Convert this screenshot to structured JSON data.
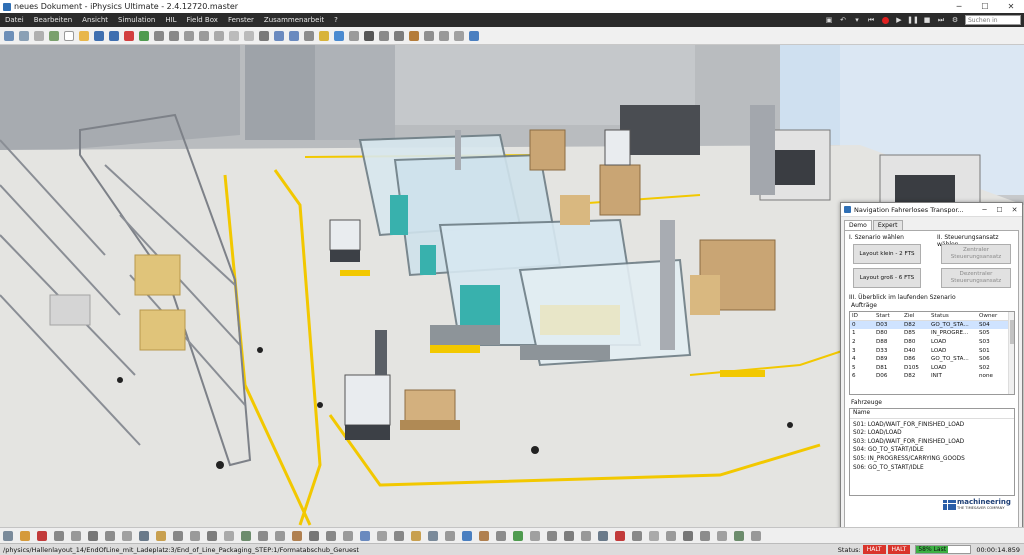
{
  "window": {
    "title": "neues Dokument - iPhysics Ultimate - 2.4.12720.master"
  },
  "menu": {
    "items": [
      "Datei",
      "Bearbeiten",
      "Ansicht",
      "Simulation",
      "HIL",
      "Field Box",
      "Fenster",
      "Zusammenarbeit",
      "?"
    ],
    "search_placeholder": "Suchen in Wissens..."
  },
  "panel": {
    "title": "Navigation Fahrerloses Transpor...",
    "tabs": [
      "Demo",
      "Expert"
    ],
    "section_scenario": "I. Szenario wählen",
    "btn_small": "Layout klein - 2 FTS",
    "btn_large": "Layout groß - 6 FTS",
    "section_control": "II. Steuerungsansatz wählen",
    "btn_central": "Zentraler Steuerungsansatz",
    "btn_decentral": "Dezentraler Steuerungsansatz",
    "section_overview": "III. Überblick im laufenden Szenario",
    "orders_label": "Aufträge",
    "orders_headers": [
      "ID",
      "Start",
      "Ziel",
      "Status",
      "Owner"
    ],
    "orders": [
      [
        "0",
        "D03",
        "D82",
        "GO_TO_STA...",
        "S04"
      ],
      [
        "1",
        "D80",
        "D85",
        "IN_PROGRE...",
        "S05"
      ],
      [
        "2",
        "D88",
        "D80",
        "LOAD",
        "S03"
      ],
      [
        "3",
        "D33",
        "D40",
        "LOAD",
        "S01"
      ],
      [
        "4",
        "D89",
        "D86",
        "GO_TO_STA...",
        "S06"
      ],
      [
        "5",
        "D81",
        "D105",
        "LOAD",
        "S02"
      ],
      [
        "6",
        "D06",
        "D82",
        "INIT",
        "none"
      ]
    ],
    "vehicles_label": "Fahrzeuge",
    "vehicles_header": "Name",
    "vehicles": [
      "S01: LOAD/WAIT_FOR_FINISHED_LOAD",
      "S02: LOAD/LOAD",
      "S03: LOAD/WAIT_FOR_FINISHED_LOAD",
      "S04: GO_TO_START/IDLE",
      "S05: IN_PROGRESS/CARRYING_GOODS",
      "S06: GO_TO_START/IDLE"
    ],
    "logo_text": "machineering",
    "logo_sub": "THE TIMESAVER COMPANY"
  },
  "status": {
    "path": "/physics/Hallenlayout_14/EndOfLine_mit_Ladeplatz:3/End_of_Line_Packaging_STEP:1/Formatabschub_Geruest",
    "label": "Status:",
    "halt1": "HALT",
    "halt2": "HALT",
    "load_text": "58% Last",
    "load_percent": 58,
    "time": "00:00:14.859"
  },
  "colors": {
    "accent": "#2f6fb5",
    "halt": "#d9342b",
    "load": "#3cb043",
    "floor_line": "#f2c800"
  }
}
